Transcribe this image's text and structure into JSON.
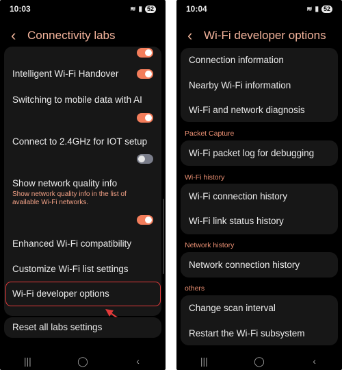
{
  "left_screen": {
    "status_time": "10:03",
    "battery": "52",
    "title": "Connectivity labs",
    "items": [
      {
        "label": "Intelligent Wi-Fi Handover",
        "toggle": "on"
      },
      {
        "label": "Switching to mobile data with AI",
        "toggle": "on"
      },
      {
        "label": "Connect to 2.4GHz for IOT setup",
        "toggle": "off"
      },
      {
        "label": "Show network quality info",
        "description": "Show network quality info in the list of available Wi-Fi networks.",
        "toggle": "on"
      },
      {
        "label": "Enhanced Wi-Fi compatibility"
      },
      {
        "label": "Customize Wi-Fi list settings"
      },
      {
        "label": "Wi-Fi developer options"
      },
      {
        "label": "Reset all labs settings"
      }
    ]
  },
  "right_screen": {
    "status_time": "10:04",
    "battery": "52",
    "title": "Wi-Fi developer options",
    "items": [
      "Connection information",
      "Nearby Wi-Fi information",
      "Wi-Fi and network diagnosis",
      "Wi-Fi packet log for debugging",
      "Wi-Fi connection history",
      "Wi-Fi link status history",
      "Network connection history",
      "Change scan interval",
      "Restart the Wi-Fi subsystem"
    ],
    "sections": [
      "Packet Capture",
      "Wi-Fi history",
      "Network history",
      "others"
    ]
  },
  "colors": {
    "accent": "#f37d5b",
    "title": "#f4b49c",
    "highlight": "#e33a3a",
    "background": "#000000",
    "card": "#171717"
  }
}
